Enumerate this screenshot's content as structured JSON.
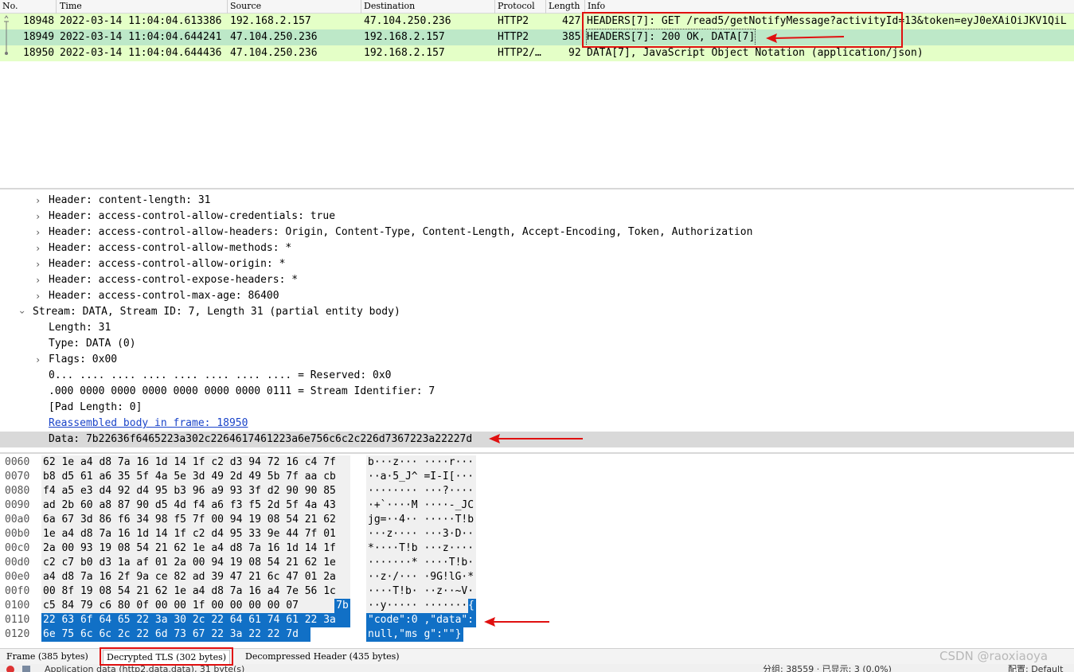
{
  "columns": {
    "no": "No.",
    "time": "Time",
    "source": "Source",
    "destination": "Destination",
    "protocol": "Protocol",
    "length": "Length",
    "info": "Info"
  },
  "packets": [
    {
      "no": "18948",
      "time": "2022-03-14 11:04:04.613386",
      "source": "192.168.2.157",
      "destination": "47.104.250.236",
      "protocol": "HTTP2",
      "length": "427",
      "info": "HEADERS[7]: GET /read5/getNotifyMessage?activityId=13&token=eyJ0eXAiOiJKV1QiL"
    },
    {
      "no": "18949",
      "time": "2022-03-14 11:04:04.644241",
      "source": "47.104.250.236",
      "destination": "192.168.2.157",
      "protocol": "HTTP2",
      "length": "385",
      "info": "HEADERS[7]: 200 OK, DATA[7]"
    },
    {
      "no": "18950",
      "time": "2022-03-14 11:04:04.644436",
      "source": "47.104.250.236",
      "destination": "192.168.2.157",
      "protocol": "HTTP2/…",
      "length": "92",
      "info": "DATA[7], JavaScript Object Notation (application/json)"
    }
  ],
  "details": [
    "Header: content-length: 31",
    "Header: access-control-allow-credentials: true",
    "Header: access-control-allow-headers: Origin, Content-Type, Content-Length, Accept-Encoding, Token, Authorization",
    "Header: access-control-allow-methods: *",
    "Header: access-control-allow-origin: *",
    "Header: access-control-expose-headers: *",
    "Header: access-control-max-age: 86400",
    "Stream: DATA, Stream ID: 7, Length 31 (partial entity body)",
    "Length: 31",
    "Type: DATA (0)",
    "Flags: 0x00",
    "0... .... .... .... .... .... .... .... = Reserved: 0x0",
    ".000 0000 0000 0000 0000 0000 0000 0111 = Stream Identifier: 7",
    "[Pad Length: 0]",
    "Reassembled body in frame: 18950",
    "Data: 7b22636f6465223a302c2264617461223a6e756c6c2c226d7367223a22227d"
  ],
  "hex": [
    {
      "offset": "0060",
      "bytes": "62 1e a4 d8 7a 16 1d 14  1f c2 d3 94 72 16 c4 7f",
      "ascii": "b···z··· ····r···"
    },
    {
      "offset": "0070",
      "bytes": "b8 d5 61 a6 35 5f 4a 5e  3d 49 2d 49 5b 7f aa cb",
      "ascii": "··a·5_J^ =I-I[···"
    },
    {
      "offset": "0080",
      "bytes": "f4 a5 e3 d4 92 d4 95 b3  96 a9 93 3f d2 90 90 85",
      "ascii": "········ ···?····"
    },
    {
      "offset": "0090",
      "bytes": "ad 2b 60 a8 87 90 d5 4d  f4 a6 f3 f5 2d 5f 4a 43",
      "ascii": "·+`····M ····-_JC"
    },
    {
      "offset": "00a0",
      "bytes": "6a 67 3d 86 f6 34 98 f5  7f 00 94 19 08 54 21 62",
      "ascii": "jg=··4·· ·····T!b"
    },
    {
      "offset": "00b0",
      "bytes": "1e a4 d8 7a 16 1d 14 1f  c2 d4 95 33 9e 44 7f 01",
      "ascii": "···z···· ···3·D··"
    },
    {
      "offset": "00c0",
      "bytes": "2a 00 93 19 08 54 21 62  1e a4 d8 7a 16 1d 14 1f",
      "ascii": "*····T!b ···z····"
    },
    {
      "offset": "00d0",
      "bytes": "c2 c7 b0 d3 1a af 01 2a  00 94 19 08 54 21 62 1e",
      "ascii": "·······* ····T!b·"
    },
    {
      "offset": "00e0",
      "bytes": "a4 d8 7a 16 2f 9a ce 82  ad 39 47 21 6c 47 01 2a",
      "ascii": "··z·/··· ·9G!lG·*"
    },
    {
      "offset": "00f0",
      "bytes": "00 8f 19 08 54 21 62 1e  a4 d8 7a 16 a4 7e 56 1c",
      "ascii": "····T!b· ··z··~V·"
    },
    {
      "offset": "0100",
      "bytes": "c5 84 79 c6 80 0f 00 00  1f 00 00 00 00 07 ",
      "bytes_hl": "7b",
      "ascii": "··y····· ·······",
      "ascii_hl": "{"
    },
    {
      "offset": "0110",
      "bytes": "",
      "bytes_hl": "22 63 6f 64 65 22 3a 30  2c 22 64 61 74 61 22 3a",
      "ascii": "",
      "ascii_hl": "\"code\":0 ,\"data\":"
    },
    {
      "offset": "0120",
      "bytes": "",
      "bytes_hl": "6e 75 6c 6c 2c 22 6d 73  67 22 3a 22 22 7d",
      "ascii": "",
      "ascii_hl": "null,\"ms g\":\"\"}"
    }
  ],
  "tabs": [
    "Frame (385 bytes)",
    "Decrypted TLS (302 bytes)",
    "Decompressed Header (435 bytes)"
  ],
  "status": {
    "text": "Application data (http2.data.data), 31 byte(s)",
    "right_text": "分组: 38559 · 已显示: 3 (0.0%)",
    "profile": "配置: Default"
  },
  "watermark": "CSDN @raoxiaoya",
  "annotation_color": "#e01010",
  "highlight_color": "#1170c6"
}
